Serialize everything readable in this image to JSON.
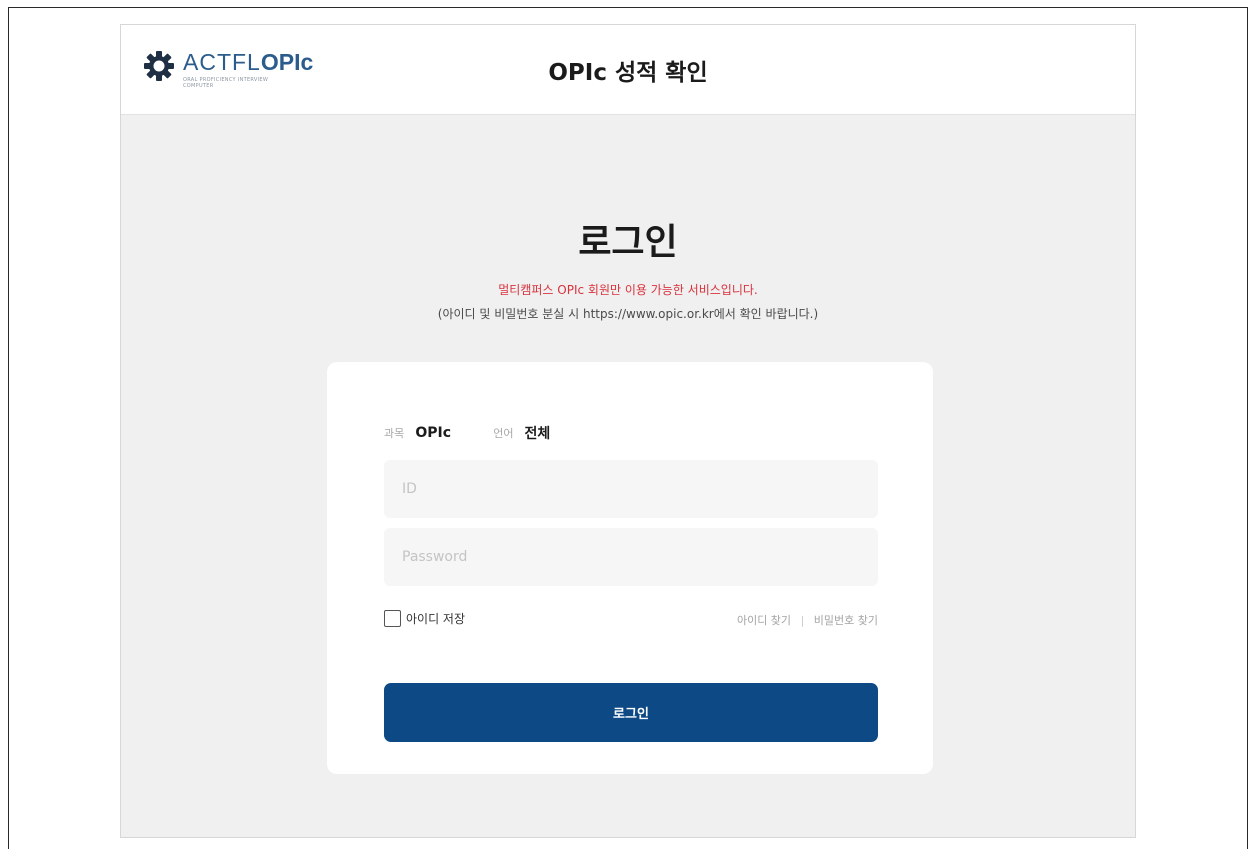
{
  "header": {
    "logo": {
      "brand_thin": "ACTFL",
      "brand_bold": "OPIc",
      "tagline": "ORAL PROFICIENCY INTERVIEW",
      "tagline_sub": "COMPUTER"
    },
    "title": "OPIc 성적 확인"
  },
  "login": {
    "title": "로그인",
    "notice_red": "멀티캠퍼스 OPIc 회원만 이용 가능한 서비스입니다.",
    "notice_gray": "(아이디 및 비밀번호 분실 시 https://www.opic.or.kr에서 확인 바랍니다.)",
    "exam": {
      "subject_label": "과목",
      "subject_value": "OPIc",
      "language_label": "언어",
      "language_value": "전체"
    },
    "id_placeholder": "ID",
    "password_placeholder": "Password",
    "remember_label": "아이디 저장",
    "find_id": "아이디 찾기",
    "divider": "|",
    "find_password": "비밀번호 찾기",
    "button_label": "로그인"
  },
  "colors": {
    "brand_blue": "#0d4a85",
    "notice_red": "#d8323c",
    "background": "#f0f0f1"
  }
}
